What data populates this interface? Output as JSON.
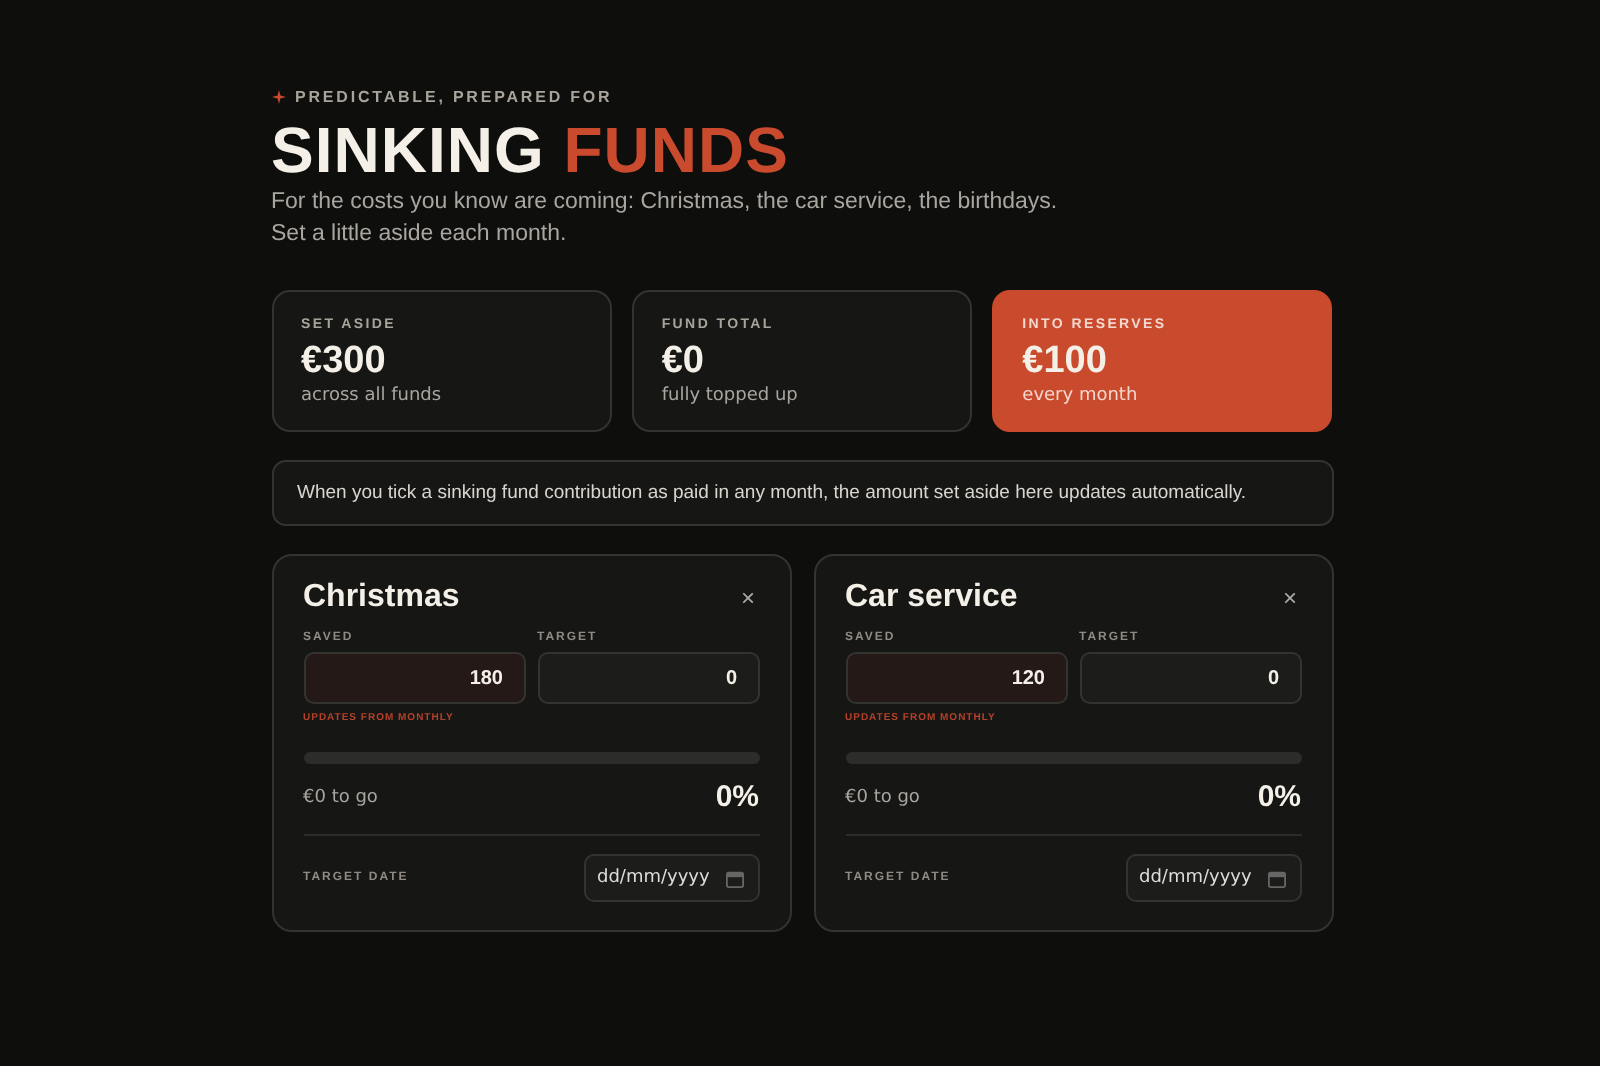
{
  "eyebrow": "PREDICTABLE, PREPARED FOR",
  "title": {
    "plain": "SINKING",
    "accent": "FUNDS"
  },
  "intro": [
    "For the costs you know are coming: Christmas, the car service, the birthdays.",
    "Set a little aside each month."
  ],
  "stats": [
    {
      "label": "SET ASIDE",
      "value": "€300",
      "caption": "across all funds",
      "highlighted": false
    },
    {
      "label": "FUND TOTAL",
      "value": "€0",
      "caption": "fully topped up",
      "highlighted": false
    },
    {
      "label": "INTO RESERVES",
      "value": "€100",
      "caption": "every month",
      "highlighted": true
    }
  ],
  "notice": "When you tick a sinking fund contribution as paid in any month, the amount set aside here updates automatically.",
  "funds": [
    {
      "name": "Christmas",
      "close": "×",
      "saved_label": "SAVED",
      "saved": "180",
      "target_label": "TARGET",
      "target": "0",
      "linked_note": "UPDATES FROM MONTHLY",
      "level": 0,
      "remaining": "€0 to go",
      "percent": "0%",
      "date_label": "TARGET DATE",
      "date_placeholder": "dd/mm/yyyy"
    },
    {
      "name": "Car service",
      "close": "×",
      "saved_label": "SAVED",
      "saved": "120",
      "target_label": "TARGET",
      "target": "0",
      "linked_note": "UPDATES FROM MONTHLY",
      "level": 0,
      "remaining": "€0 to go",
      "percent": "0%",
      "date_label": "TARGET DATE",
      "date_placeholder": "dd/mm/yyyy"
    }
  ]
}
